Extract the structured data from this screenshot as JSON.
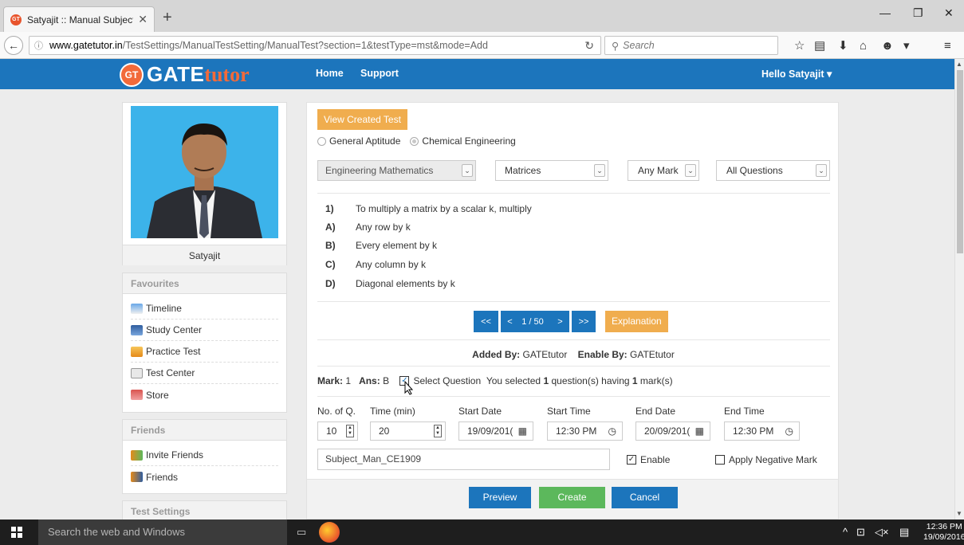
{
  "browser": {
    "tab_title": "Satyajit :: Manual Subject ...",
    "url_domain": "www.gatetutor.in",
    "url_path": "/TestSettings/ManualTestSetting/ManualTest?section=1&testType=mst&mode=Add",
    "search_placeholder": "Search"
  },
  "site": {
    "logo_badge": "GT",
    "logo_gate": "GATE",
    "logo_tutor": "tutor",
    "nav": [
      "Home",
      "Support"
    ],
    "greeting": "Hello Satyajit"
  },
  "profile": {
    "name": "Satyajit"
  },
  "favourites": {
    "title": "Favourites",
    "items": [
      "Timeline",
      "Study Center",
      "Practice Test",
      "Test Center",
      "Store"
    ]
  },
  "friends": {
    "title": "Friends",
    "items": [
      "Invite Friends",
      "Friends"
    ]
  },
  "test_settings": {
    "title": "Test Settings"
  },
  "main": {
    "view_created_label": "View Created Test",
    "sections": [
      "General Aptitude",
      "Chemical Engineering"
    ],
    "selected_section": "Chemical Engineering",
    "subject": "Engineering Mathematics",
    "topic": "Matrices",
    "mark_filter": "Any Mark",
    "question_filter": "All Questions",
    "question": {
      "number": "1)",
      "text": "To multiply a matrix by a scalar k, multiply",
      "options": [
        {
          "key": "A)",
          "text": "Any row by k"
        },
        {
          "key": "B)",
          "text": "Every element by k"
        },
        {
          "key": "C)",
          "text": "Any column by k"
        },
        {
          "key": "D)",
          "text": "Diagonal elements by k"
        }
      ]
    },
    "pager": {
      "first": "<<",
      "prev": "<",
      "counter": "1 / 50",
      "next": ">",
      "last": ">>",
      "explanation": "Explanation"
    },
    "added_by_label": "Added By:",
    "added_by": "GATEtutor",
    "enable_by_label": "Enable By:",
    "enable_by": "GATEtutor",
    "mark_label": "Mark:",
    "mark": "1",
    "ans_label": "Ans:",
    "ans": "B",
    "select_question_label": "Select Question",
    "selected_prefix": "You selected",
    "selected_count": "1",
    "selected_mid": "question(s) having",
    "selected_marks": "1",
    "selected_suffix": "mark(s)",
    "fields": {
      "no_q_label": "No. of Q.",
      "no_q": "10",
      "time_label": "Time (min)",
      "time": "20",
      "start_date_label": "Start Date",
      "start_date": "19/09/201(",
      "start_time_label": "Start Time",
      "start_time": "12:30 PM",
      "end_date_label": "End Date",
      "end_date": "20/09/201(",
      "end_time_label": "End Time",
      "end_time": "12:30 PM"
    },
    "test_name": "Subject_Man_CE1909",
    "enable_label": "Enable",
    "negative_label": "Apply Negative Mark",
    "buttons": {
      "preview": "Preview",
      "create": "Create",
      "cancel": "Cancel"
    }
  },
  "taskbar": {
    "search_placeholder": "Search the web and Windows",
    "time": "12:36 PM",
    "date": "19/09/2016"
  },
  "colors": {
    "brand_blue": "#1c75bc",
    "orange": "#f0ad4e",
    "green": "#5cb85c"
  }
}
